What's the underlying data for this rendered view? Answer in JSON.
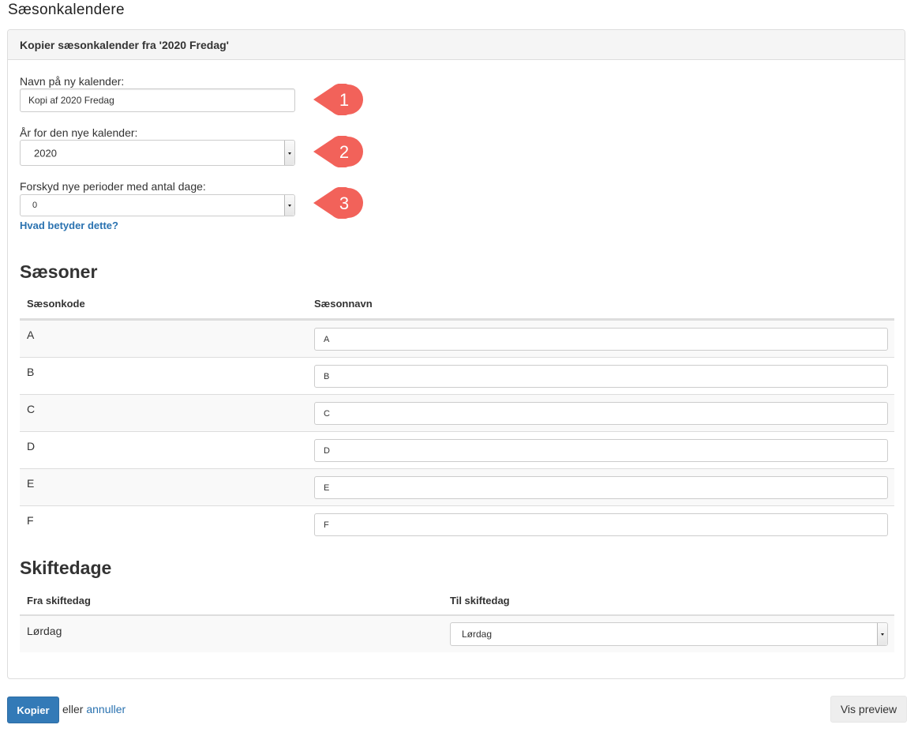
{
  "page_title": "Sæsonkalendere",
  "panel": {
    "heading": "Kopier sæsonkalender fra '2020 Fredag'",
    "name_label": "Navn på ny kalender:",
    "name_value": "Kopi af 2020 Fredag",
    "year_label": "År for den nye kalender:",
    "year_value": "2020",
    "shift_label": "Forskyd nye perioder med antal dage:",
    "shift_value": "0",
    "help_link": "Hvad betyder dette?",
    "callouts": [
      "1",
      "2",
      "3"
    ],
    "callout_color": "#f2625a"
  },
  "seasons": {
    "title": "Sæsoner",
    "col_code": "Sæsonkode",
    "col_name": "Sæsonnavn",
    "rows": [
      {
        "code": "A",
        "name": "A"
      },
      {
        "code": "B",
        "name": "B"
      },
      {
        "code": "C",
        "name": "C"
      },
      {
        "code": "D",
        "name": "D"
      },
      {
        "code": "E",
        "name": "E"
      },
      {
        "code": "F",
        "name": "F"
      }
    ]
  },
  "changeover": {
    "title": "Skiftedage",
    "col_from": "Fra skiftedag",
    "col_to": "Til skiftedag",
    "from_value": "Lørdag",
    "to_value": "Lørdag"
  },
  "footer": {
    "copy_button": "Kopier",
    "or_text": "eller",
    "cancel_link": "annuller",
    "preview_button": "Vis preview"
  },
  "colors": {
    "primary": "#337ab7",
    "link": "#2a72b0"
  }
}
